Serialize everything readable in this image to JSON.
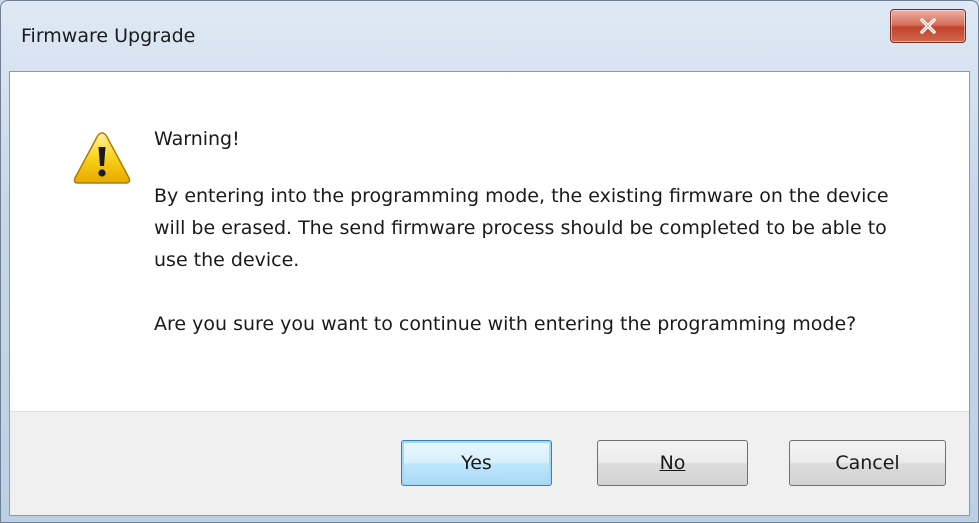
{
  "window": {
    "title": "Firmware Upgrade"
  },
  "dialog": {
    "heading": "Warning!",
    "message": "By entering into the programming mode, the existing firmware on the device will be erased. The send firmware process should be completed to be able to use the device.",
    "question": "Are you sure you want to continue with entering the programming mode?",
    "icon": "warning-triangle-icon"
  },
  "buttons": {
    "yes_label": "Yes",
    "no_label": "No",
    "cancel_label": "Cancel"
  },
  "colors": {
    "close_button": "#c0432c",
    "default_button_border": "#3c7fb1",
    "warning_yellow": "#f5c400"
  }
}
